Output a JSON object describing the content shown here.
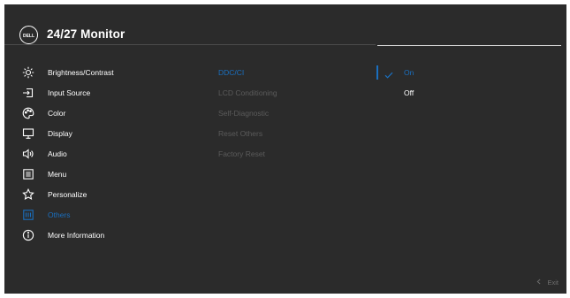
{
  "header": {
    "title": "24/27 Monitor",
    "logo_text": "DELL"
  },
  "menu": [
    {
      "label": "Brightness/Contrast",
      "icon": "sun-icon"
    },
    {
      "label": "Input Source",
      "icon": "input-icon"
    },
    {
      "label": "Color",
      "icon": "palette-icon"
    },
    {
      "label": "Display",
      "icon": "display-icon"
    },
    {
      "label": "Audio",
      "icon": "speaker-icon"
    },
    {
      "label": "Menu",
      "icon": "menu-icon"
    },
    {
      "label": "Personalize",
      "icon": "star-icon"
    },
    {
      "label": "Others",
      "icon": "others-icon",
      "active": true
    },
    {
      "label": "More Information",
      "icon": "info-icon"
    }
  ],
  "submenu": [
    {
      "label": "DDC/CI",
      "active": true
    },
    {
      "label": "LCD Conditioning"
    },
    {
      "label": "Self-Diagnostic"
    },
    {
      "label": "Reset Others"
    },
    {
      "label": "Factory Reset"
    }
  ],
  "options": [
    {
      "label": "On",
      "selected": true
    },
    {
      "label": "Off"
    }
  ],
  "footer": {
    "exit_label": "Exit"
  },
  "colors": {
    "accent": "#1a6fbf",
    "background": "#2b2b2b",
    "disabled_text": "#5b5b5b"
  }
}
